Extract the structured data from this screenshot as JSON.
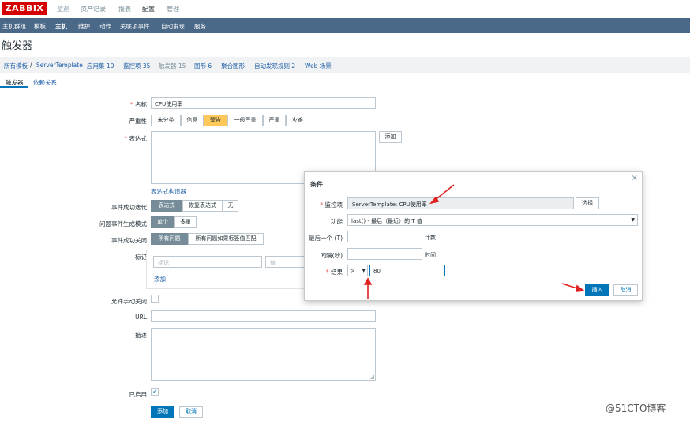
{
  "topbar": {
    "logo": "ZABBIX",
    "menu": [
      "监测",
      "资产记录",
      "报表",
      "配置",
      "管理"
    ],
    "active_menu": "配置"
  },
  "subnav": {
    "items": [
      "主机群组",
      "模板",
      "主机",
      "维护",
      "动作",
      "关联项事件",
      "自动发现",
      "服务"
    ],
    "active": "主机"
  },
  "page_title": "触发器",
  "breadcrumb": {
    "all_templates": "所有模板",
    "separator": "/",
    "template": "ServerTemplate",
    "items": [
      "应用集 10",
      "监控项 35",
      "触发器 15",
      "图形 6",
      "聚合图形",
      "自动发现规则 2",
      "Web 场景"
    ]
  },
  "tabs": [
    "触发器",
    "依赖关系"
  ],
  "form": {
    "name_label": "名称",
    "name_value": "CPU使用率",
    "severity_label": "严重性",
    "severity_options": [
      "未分类",
      "信息",
      "警告",
      "一般严重",
      "严重",
      "灾难"
    ],
    "severity_selected": "警告",
    "expression_label": "表达式",
    "add_button": "添加",
    "expression_builder_link": "表达式构造器",
    "ok_event_gen_label": "事件成功迭代",
    "ok_event_gen_options": [
      "表达式",
      "恢复表达式",
      "无"
    ],
    "problem_mode_label": "问题事件生成模式",
    "problem_mode_options": [
      "单个",
      "多重"
    ],
    "ok_close_label": "事件成功关闭",
    "ok_close_options": [
      "所有问题",
      "所有问题如果标签值匹配"
    ],
    "tags_label": "标记",
    "tag_placeholder": "标记",
    "value_placeholder": "值",
    "tag_add_link": "添加",
    "manual_close_label": "允许手动关闭",
    "url_label": "URL",
    "description_label": "描述",
    "enabled_label": "已启用",
    "submit_add": "添加",
    "submit_cancel": "取消"
  },
  "dialog": {
    "title": "条件",
    "item_label": "监控项",
    "item_value": "ServerTemplate: CPU使用率",
    "select_button": "选择",
    "function_label": "功能",
    "function_value": "last() - 最后（最近）的 T 值",
    "last_of_label": "最后一个 (T)",
    "count_suffix": "计数",
    "interval_label": "间隔(秒)",
    "time_suffix": "时间",
    "result_label": "结果",
    "operator_value": ">",
    "result_value": "80",
    "insert_button": "插入",
    "cancel_button": "取消",
    "close_glyph": "×"
  },
  "watermark": "@51CTO博客",
  "colors": {
    "logo_red": "#d40000",
    "nav_blue": "#4a6887",
    "primary_blue": "#0275b8",
    "warning_yellow": "#ffc859",
    "annotation_red": "#e02020"
  }
}
